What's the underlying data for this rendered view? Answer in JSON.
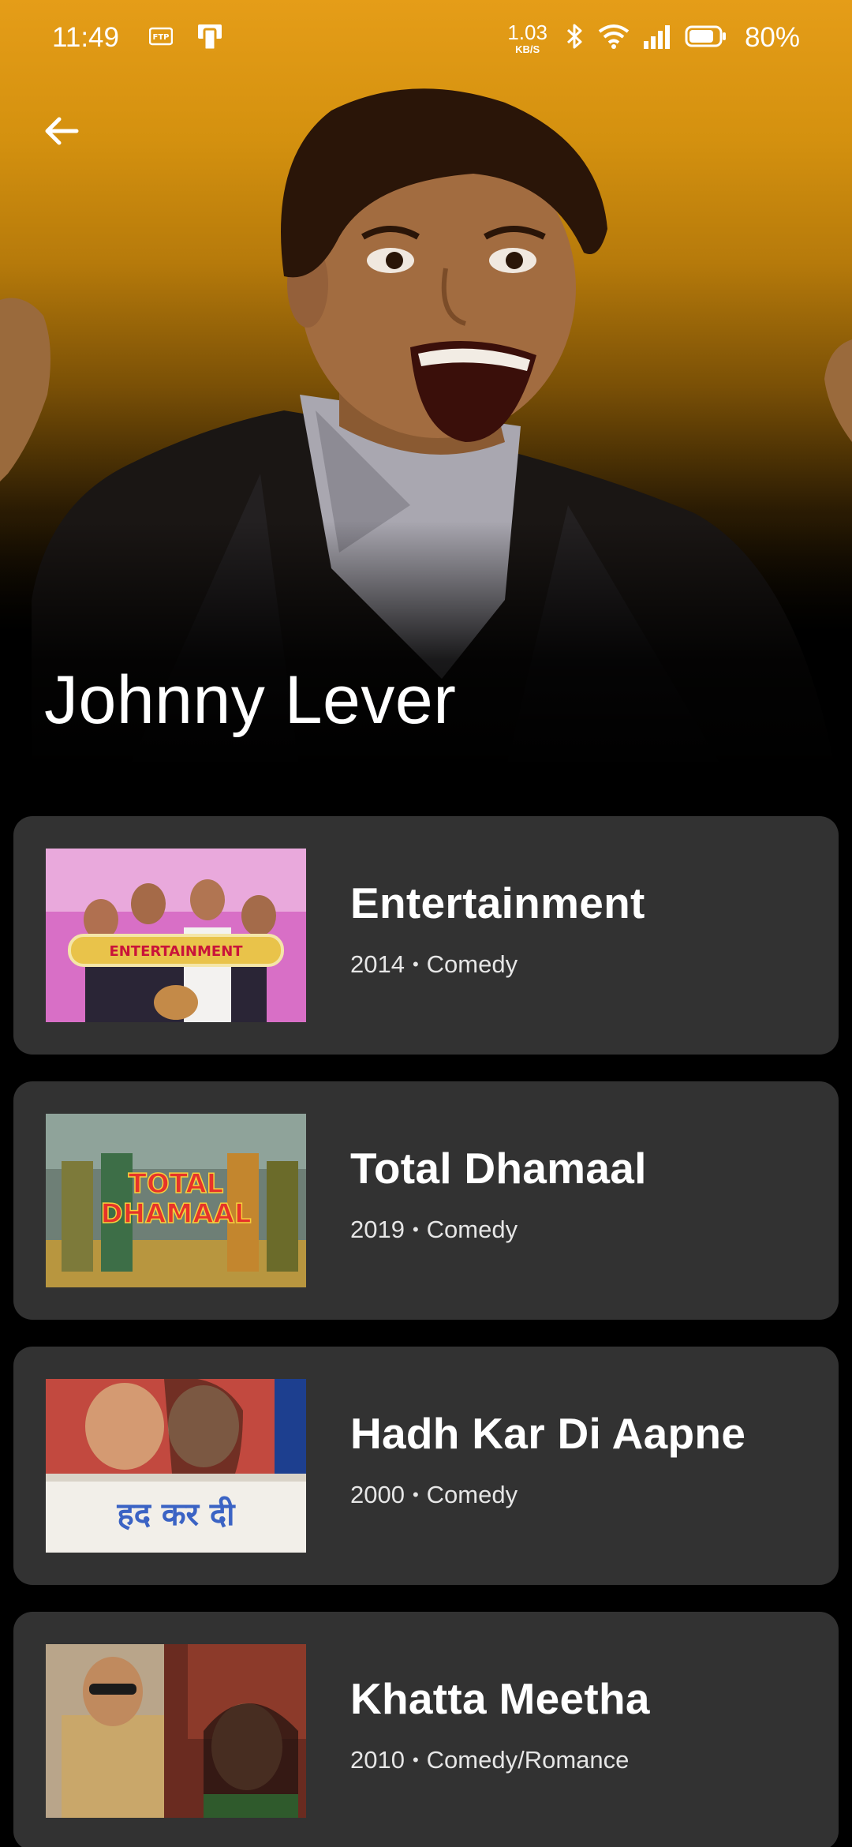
{
  "status_bar": {
    "time": "11:49",
    "net_speed_value": "1.03",
    "net_speed_unit": "KB/S",
    "battery_percent": "80%",
    "icons": [
      "ftp-icon",
      "device-icon",
      "bluetooth-icon",
      "wifi-icon",
      "signal-icon",
      "battery-icon"
    ]
  },
  "header": {
    "back_icon": "arrow-back-icon",
    "actor_name": "Johnny Lever"
  },
  "colors": {
    "hero_top": "#e59d18",
    "background": "#000000",
    "card": "#323232",
    "text_primary": "#ffffff"
  },
  "movies": [
    {
      "title": "Entertainment",
      "year": "2014",
      "genre": "Comedy",
      "separator": "•"
    },
    {
      "title": "Total Dhamaal",
      "year": "2019",
      "genre": "Comedy",
      "separator": "•"
    },
    {
      "title": "Hadh Kar Di Aapne",
      "year": "2000",
      "genre": "Comedy",
      "separator": "•"
    },
    {
      "title": "Khatta Meetha",
      "year": "2010",
      "genre": "Comedy/Romance",
      "separator": "•"
    }
  ]
}
